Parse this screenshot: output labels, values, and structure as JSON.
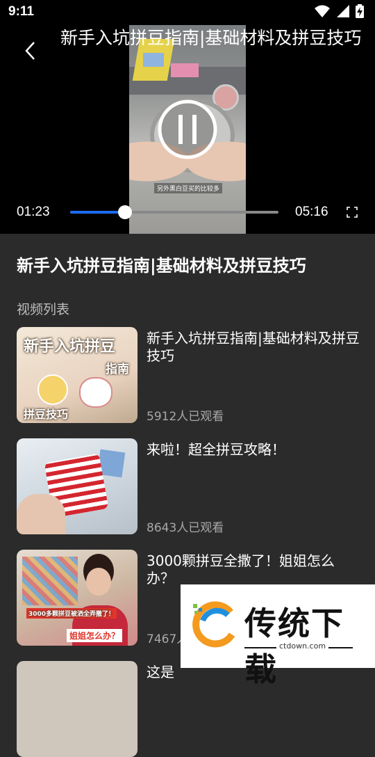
{
  "status_bar": {
    "time": "9:11"
  },
  "player": {
    "title": "新手入坑拼豆指南|基础材料及拼豆技巧",
    "frame_caption": "另外黑白豆买的比较多",
    "current_time": "01:23",
    "total_time": "05:16",
    "progress": 0.262
  },
  "content": {
    "title": "新手入坑拼豆指南|基础材料及拼豆技巧",
    "section_label": "视频列表"
  },
  "videos": [
    {
      "title": "新手入坑拼豆指南|基础材料及拼豆技巧",
      "views": "5912人已观看",
      "thumb_text": [
        "新手入坑拼豆",
        "指南",
        "拼豆技巧"
      ]
    },
    {
      "title": "来啦！超全拼豆攻略！",
      "views": "8643人已观看"
    },
    {
      "title": "3000颗拼豆全撒了！姐姐怎么办？",
      "views": "7467人已观看",
      "thumb_text": [
        "3000多颗拼豆被洒全弄撒了！",
        "姐姐怎么办？"
      ]
    },
    {
      "title": "这是",
      "views": ""
    }
  ],
  "watermark": {
    "name": "传统下载",
    "url": "ctdown.com"
  },
  "colors": {
    "accent": "#1e6bf0",
    "background": "#2b2b2b",
    "player_bg": "#000000"
  }
}
